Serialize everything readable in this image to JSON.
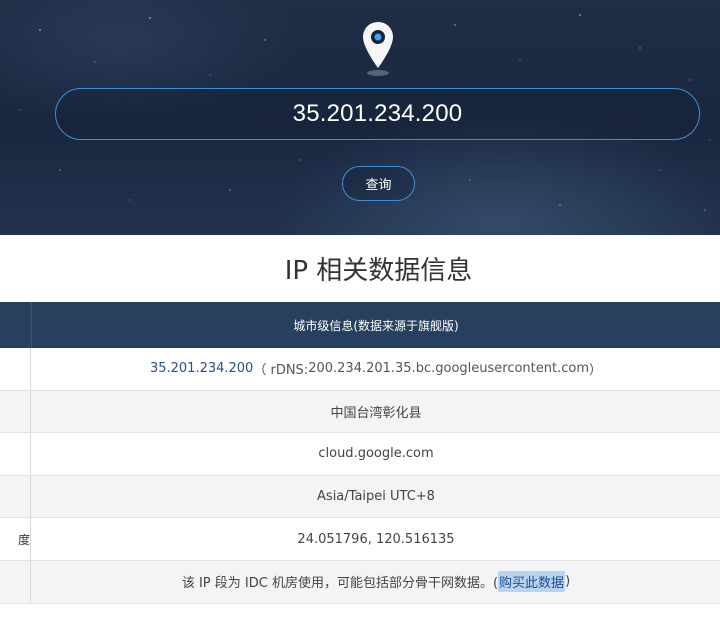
{
  "search": {
    "ip_value": "35.201.234.200",
    "query_label": "查询"
  },
  "section": {
    "title": "IP 相关数据信息"
  },
  "table": {
    "header": "城市级信息(数据来源于旗舰版)",
    "rows": [
      {
        "label": "",
        "ip": "35.201.234.200",
        "rdns_prefix": "（ rDNS: ",
        "rdns": "200.234.201.35.bc.googleusercontent.com",
        "rdns_suffix": " ）"
      },
      {
        "label": "",
        "value": "中国台湾彰化县"
      },
      {
        "label": "",
        "value": "cloud.google.com"
      },
      {
        "label": "",
        "value": "Asia/Taipei UTC+8"
      },
      {
        "label": "度",
        "value": "24.051796, 120.516135"
      },
      {
        "label": "",
        "note": "该 IP 段为 IDC 机房使用，可能包括部分骨干网数据。(",
        "buy_link": "购买此数据",
        "note_end": " )"
      }
    ]
  },
  "colors": {
    "hero_bg": "#1f2d45",
    "accent_border": "#3f8fd6",
    "table_header_bg": "#27405f",
    "link_color": "#2b4f86"
  }
}
